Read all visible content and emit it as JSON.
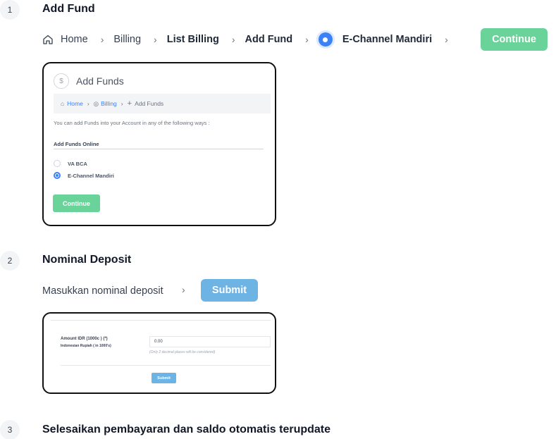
{
  "steps": [
    {
      "number": "1",
      "title": "Add Fund"
    },
    {
      "number": "2",
      "title": "Nominal Deposit"
    },
    {
      "number": "3",
      "title": "Selesaikan pembayaran dan saldo otomatis terupdate"
    }
  ],
  "breadcrumb": {
    "home": "Home",
    "billing": "Billing",
    "list_billing": "List Billing",
    "add_fund": "Add Fund",
    "channel": "E-Channel Mandiri",
    "separator": "›"
  },
  "continue_label": "Continue",
  "add_funds_panel": {
    "title": "Add Funds",
    "breadcrumb": {
      "home": "Home",
      "billing": "Billing",
      "current": "Add Funds"
    },
    "intro": "You can add Funds into your Account in any of the following ways :",
    "section_title": "Add Funds Online",
    "options": [
      {
        "label": "VA BCA",
        "selected": false
      },
      {
        "label": "E-Channel Mandiri",
        "selected": true
      }
    ],
    "button_label": "Continue"
  },
  "deposit": {
    "instruction": "Masukkan nominal deposit",
    "separator": "›",
    "submit_label": "Submit"
  },
  "deposit_panel": {
    "amount_label": "Amount IDR (1000c ) (*)",
    "amount_sublabel": "Indonesian Rupiah ( in 1000's)",
    "amount_value": "0.00",
    "hint": "(Only 2 decimal places will be considered)",
    "submit_label": "Submit"
  },
  "colors": {
    "green": "#6ad39a",
    "blue": "#6db3e3",
    "radio_blue": "#3b82f6"
  }
}
